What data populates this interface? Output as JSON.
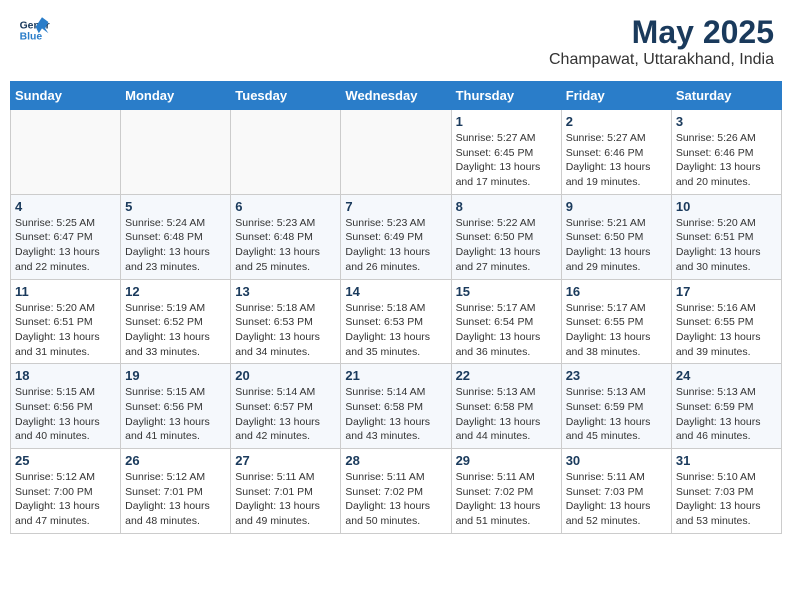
{
  "logo": {
    "general": "General",
    "blue": "Blue"
  },
  "title": "May 2025",
  "subtitle": "Champawat, Uttarakhand, India",
  "days_header": [
    "Sunday",
    "Monday",
    "Tuesday",
    "Wednesday",
    "Thursday",
    "Friday",
    "Saturday"
  ],
  "weeks": [
    [
      {
        "day": "",
        "info": ""
      },
      {
        "day": "",
        "info": ""
      },
      {
        "day": "",
        "info": ""
      },
      {
        "day": "",
        "info": ""
      },
      {
        "day": "1",
        "info": "Sunrise: 5:27 AM\nSunset: 6:45 PM\nDaylight: 13 hours\nand 17 minutes."
      },
      {
        "day": "2",
        "info": "Sunrise: 5:27 AM\nSunset: 6:46 PM\nDaylight: 13 hours\nand 19 minutes."
      },
      {
        "day": "3",
        "info": "Sunrise: 5:26 AM\nSunset: 6:46 PM\nDaylight: 13 hours\nand 20 minutes."
      }
    ],
    [
      {
        "day": "4",
        "info": "Sunrise: 5:25 AM\nSunset: 6:47 PM\nDaylight: 13 hours\nand 22 minutes."
      },
      {
        "day": "5",
        "info": "Sunrise: 5:24 AM\nSunset: 6:48 PM\nDaylight: 13 hours\nand 23 minutes."
      },
      {
        "day": "6",
        "info": "Sunrise: 5:23 AM\nSunset: 6:48 PM\nDaylight: 13 hours\nand 25 minutes."
      },
      {
        "day": "7",
        "info": "Sunrise: 5:23 AM\nSunset: 6:49 PM\nDaylight: 13 hours\nand 26 minutes."
      },
      {
        "day": "8",
        "info": "Sunrise: 5:22 AM\nSunset: 6:50 PM\nDaylight: 13 hours\nand 27 minutes."
      },
      {
        "day": "9",
        "info": "Sunrise: 5:21 AM\nSunset: 6:50 PM\nDaylight: 13 hours\nand 29 minutes."
      },
      {
        "day": "10",
        "info": "Sunrise: 5:20 AM\nSunset: 6:51 PM\nDaylight: 13 hours\nand 30 minutes."
      }
    ],
    [
      {
        "day": "11",
        "info": "Sunrise: 5:20 AM\nSunset: 6:51 PM\nDaylight: 13 hours\nand 31 minutes."
      },
      {
        "day": "12",
        "info": "Sunrise: 5:19 AM\nSunset: 6:52 PM\nDaylight: 13 hours\nand 33 minutes."
      },
      {
        "day": "13",
        "info": "Sunrise: 5:18 AM\nSunset: 6:53 PM\nDaylight: 13 hours\nand 34 minutes."
      },
      {
        "day": "14",
        "info": "Sunrise: 5:18 AM\nSunset: 6:53 PM\nDaylight: 13 hours\nand 35 minutes."
      },
      {
        "day": "15",
        "info": "Sunrise: 5:17 AM\nSunset: 6:54 PM\nDaylight: 13 hours\nand 36 minutes."
      },
      {
        "day": "16",
        "info": "Sunrise: 5:17 AM\nSunset: 6:55 PM\nDaylight: 13 hours\nand 38 minutes."
      },
      {
        "day": "17",
        "info": "Sunrise: 5:16 AM\nSunset: 6:55 PM\nDaylight: 13 hours\nand 39 minutes."
      }
    ],
    [
      {
        "day": "18",
        "info": "Sunrise: 5:15 AM\nSunset: 6:56 PM\nDaylight: 13 hours\nand 40 minutes."
      },
      {
        "day": "19",
        "info": "Sunrise: 5:15 AM\nSunset: 6:56 PM\nDaylight: 13 hours\nand 41 minutes."
      },
      {
        "day": "20",
        "info": "Sunrise: 5:14 AM\nSunset: 6:57 PM\nDaylight: 13 hours\nand 42 minutes."
      },
      {
        "day": "21",
        "info": "Sunrise: 5:14 AM\nSunset: 6:58 PM\nDaylight: 13 hours\nand 43 minutes."
      },
      {
        "day": "22",
        "info": "Sunrise: 5:13 AM\nSunset: 6:58 PM\nDaylight: 13 hours\nand 44 minutes."
      },
      {
        "day": "23",
        "info": "Sunrise: 5:13 AM\nSunset: 6:59 PM\nDaylight: 13 hours\nand 45 minutes."
      },
      {
        "day": "24",
        "info": "Sunrise: 5:13 AM\nSunset: 6:59 PM\nDaylight: 13 hours\nand 46 minutes."
      }
    ],
    [
      {
        "day": "25",
        "info": "Sunrise: 5:12 AM\nSunset: 7:00 PM\nDaylight: 13 hours\nand 47 minutes."
      },
      {
        "day": "26",
        "info": "Sunrise: 5:12 AM\nSunset: 7:01 PM\nDaylight: 13 hours\nand 48 minutes."
      },
      {
        "day": "27",
        "info": "Sunrise: 5:11 AM\nSunset: 7:01 PM\nDaylight: 13 hours\nand 49 minutes."
      },
      {
        "day": "28",
        "info": "Sunrise: 5:11 AM\nSunset: 7:02 PM\nDaylight: 13 hours\nand 50 minutes."
      },
      {
        "day": "29",
        "info": "Sunrise: 5:11 AM\nSunset: 7:02 PM\nDaylight: 13 hours\nand 51 minutes."
      },
      {
        "day": "30",
        "info": "Sunrise: 5:11 AM\nSunset: 7:03 PM\nDaylight: 13 hours\nand 52 minutes."
      },
      {
        "day": "31",
        "info": "Sunrise: 5:10 AM\nSunset: 7:03 PM\nDaylight: 13 hours\nand 53 minutes."
      }
    ]
  ]
}
